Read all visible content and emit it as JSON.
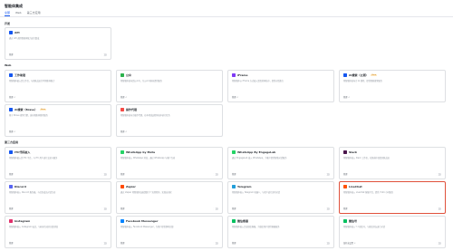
{
  "header": {
    "title": "智能体集成",
    "tabs": [
      "全部",
      "Web",
      "第三方应用"
    ]
  },
  "sections": {
    "api": "开发",
    "web": "Web",
    "third": "第三方应用"
  },
  "cards": {
    "api": {
      "name": "API",
      "desc": "通过 API 调用智能体能力进行集成",
      "footer": "管理"
    },
    "web1": {
      "name": "工作助理",
      "desc": "将智能体嵌入到工作台，与团队成员共享智能体能力",
      "footer": "管理 ↗"
    },
    "web2": {
      "name": "公众",
      "desc": "将智能体发布到公众号，为公众号粉丝提供服务",
      "footer": "管理 ↗"
    },
    "web3": {
      "name": "iFrame",
      "desc": "将智能体以 iFrame 方式嵌入到您的网站中，提供对话能力",
      "footer": "管理 ↗"
    },
    "web4": {
      "name": "AI搜索（公测）",
      "badge": "Beta",
      "desc": "将智能体发布为 AI 搜索，提供智能搜索服务",
      "footer": "管理 ↗"
    },
    "web5": {
      "name": "AI搜索（Brave）",
      "badge": "Beta",
      "desc": "基于 Brave 搜索引擎，发布智能体搜索服务",
      "footer": "管理 ↗"
    },
    "web6": {
      "name": "操作代理",
      "desc": "将智能体发布为操作代理，在本地或远程环境中执行任务",
      "footer": "管理 ↗"
    },
    "t1": {
      "name": "ITC代码嵌入",
      "desc": "将智能体嵌入到 ITC 平台，与 ITC 用户进行交流与服务",
      "footer": "管理"
    },
    "t2": {
      "name": "WhatsApp by Meta",
      "desc": "将智能体接入 WhatsApp 消息，通过 WhatsApp 与客户互动",
      "footer": "管理"
    },
    "t3": {
      "name": "WhatsApp By EngageLab",
      "desc": "通过 EngageLab 接入 WhatsApp，为客户提供智能对话服务",
      "footer": "管理"
    },
    "t4": {
      "name": "Slack",
      "desc": "将智能体接入 Slack 工作区，在频道中回复团队成员",
      "footer": "管理"
    },
    "t5": {
      "name": "Discord",
      "desc": "将智能体接入 Discord 服务器，与社区成员对话互动",
      "footer": "管理"
    },
    "t6": {
      "name": "Zapier",
      "desc": "通过 Zapier 将智能体连接到数千个应用程序，实现自动化",
      "footer": "管理"
    },
    "t7": {
      "name": "Telegram",
      "desc": "将智能体接入 Telegram 机器人，与用户进行实时对话",
      "footer": "管理"
    },
    "t8": {
      "name": "LiveChat",
      "desc": "将智能体接入 LiveChat 客服平台，提供 7x24 小时服务",
      "footer": "管理"
    },
    "t9": {
      "name": "Instagram",
      "desc": "将智能体接入 Instagram 私信，与粉丝互动并回复消息",
      "footer": "管理"
    },
    "t10": {
      "name": "Facebook Messenger",
      "desc": "将智能体接入 Facebook Messenger，为用户提供即时回复",
      "footer": "管理"
    },
    "t11": {
      "name": "微信客服",
      "desc": "将智能体接入企业微信客服，为微信用户提供客服服务",
      "footer": "管理"
    },
    "t12": {
      "name": "微信号",
      "desc": "将智能体接入个人微信号，与微信好友进行对话",
      "footer": "加好友设置 ↗"
    }
  },
  "colors": {
    "accent": "#1456f0",
    "highlight": "#e0513c"
  }
}
